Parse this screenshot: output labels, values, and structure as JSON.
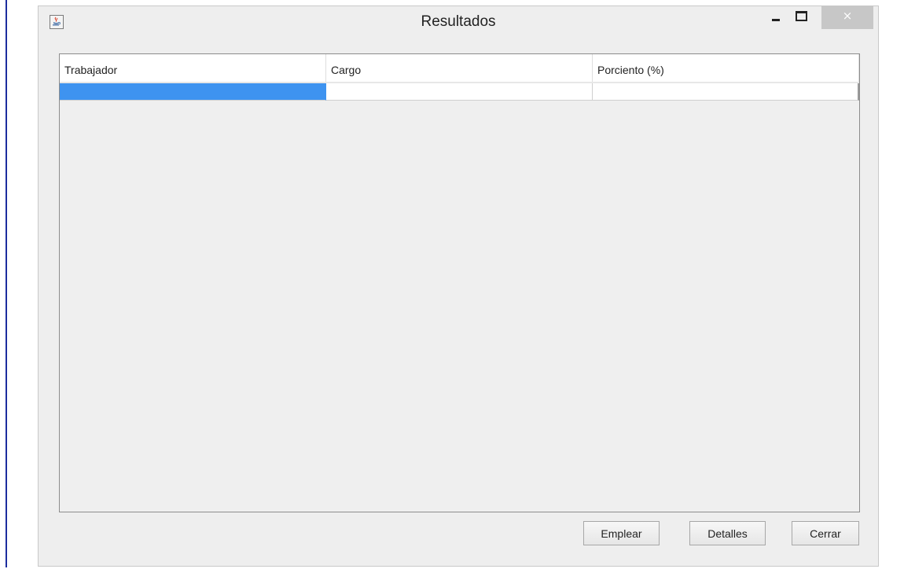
{
  "window": {
    "title": "Resultados",
    "icon": "java-cup-icon",
    "controls": {
      "minimize": "minimize-icon",
      "maximize": "maximize-icon",
      "close": "close-icon",
      "close_glyph": "×"
    }
  },
  "table": {
    "columns": [
      "Trabajador",
      "Cargo",
      "Porciento (%)"
    ],
    "rows": [
      [
        "",
        "",
        ""
      ]
    ],
    "selected_cell_color": "#3e93f0"
  },
  "buttons": {
    "emplear": "Emplear",
    "detalles": "Detalles",
    "cerrar": "Cerrar"
  }
}
